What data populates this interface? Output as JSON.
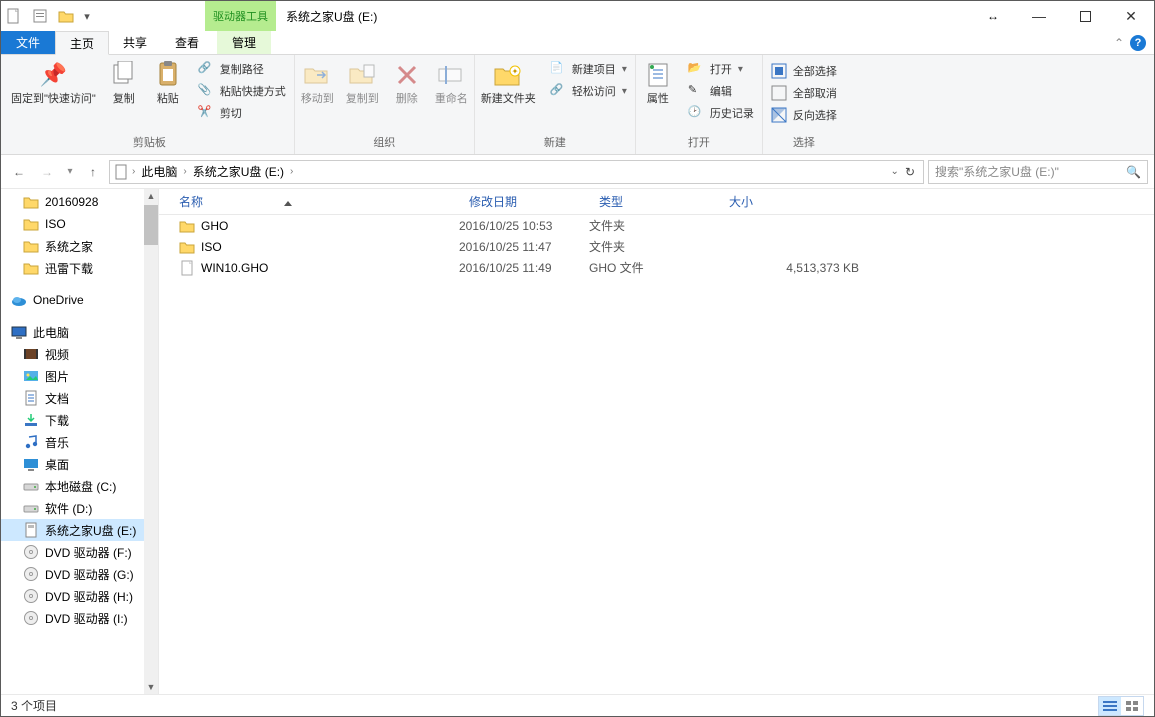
{
  "title_bar": {
    "tool_context_label": "驱动器工具",
    "window_title": "系统之家U盘 (E:)"
  },
  "tabs": {
    "file": "文件",
    "home": "主页",
    "share": "共享",
    "view": "查看",
    "manage": "管理"
  },
  "ribbon": {
    "clipboard": {
      "pin": "固定到\"快速访问\"",
      "copy": "复制",
      "paste": "粘贴",
      "copy_path": "复制路径",
      "paste_shortcut": "粘贴快捷方式",
      "cut": "剪切",
      "group": "剪贴板"
    },
    "organize": {
      "move_to": "移动到",
      "copy_to": "复制到",
      "delete": "删除",
      "rename": "重命名",
      "group": "组织"
    },
    "new": {
      "new_folder": "新建文件夹",
      "new_item": "新建项目",
      "easy_access": "轻松访问",
      "group": "新建"
    },
    "open": {
      "properties": "属性",
      "open": "打开",
      "edit": "编辑",
      "history": "历史记录",
      "group": "打开"
    },
    "select": {
      "select_all": "全部选择",
      "select_none": "全部取消",
      "invert": "反向选择",
      "group": "选择"
    }
  },
  "breadcrumb": {
    "root": "此电脑",
    "current": "系统之家U盘 (E:)"
  },
  "search": {
    "placeholder": "搜索\"系统之家U盘 (E:)\""
  },
  "tree": [
    {
      "label": "20160928",
      "icon": "folder",
      "depth": 1
    },
    {
      "label": "ISO",
      "icon": "folder",
      "depth": 1
    },
    {
      "label": "系统之家",
      "icon": "folder",
      "depth": 1
    },
    {
      "label": "迅雷下载",
      "icon": "folder",
      "depth": 1
    },
    {
      "label": "OneDrive",
      "icon": "onedrive",
      "depth": 0,
      "spaced": true
    },
    {
      "label": "此电脑",
      "icon": "pc",
      "depth": 0,
      "spaced": true
    },
    {
      "label": "视频",
      "icon": "video",
      "depth": 1
    },
    {
      "label": "图片",
      "icon": "pictures",
      "depth": 1
    },
    {
      "label": "文档",
      "icon": "docs",
      "depth": 1
    },
    {
      "label": "下载",
      "icon": "downloads",
      "depth": 1
    },
    {
      "label": "音乐",
      "icon": "music",
      "depth": 1
    },
    {
      "label": "桌面",
      "icon": "desktop",
      "depth": 1
    },
    {
      "label": "本地磁盘 (C:)",
      "icon": "drive",
      "depth": 1
    },
    {
      "label": "软件 (D:)",
      "icon": "drive",
      "depth": 1
    },
    {
      "label": "系统之家U盘 (E:)",
      "icon": "usb",
      "depth": 1,
      "selected": true
    },
    {
      "label": "DVD 驱动器 (F:)",
      "icon": "dvd",
      "depth": 1
    },
    {
      "label": "DVD 驱动器 (G:)",
      "icon": "dvd",
      "depth": 1
    },
    {
      "label": "DVD 驱动器 (H:)",
      "icon": "dvd",
      "depth": 1
    },
    {
      "label": "DVD 驱动器 (I:)",
      "icon": "dvd",
      "depth": 1
    }
  ],
  "columns": {
    "name": "名称",
    "date": "修改日期",
    "type": "类型",
    "size": "大小"
  },
  "rows": [
    {
      "name": "GHO",
      "date": "2016/10/25 10:53",
      "type": "文件夹",
      "size": "",
      "icon": "folder"
    },
    {
      "name": "ISO",
      "date": "2016/10/25 11:47",
      "type": "文件夹",
      "size": "",
      "icon": "folder"
    },
    {
      "name": "WIN10.GHO",
      "date": "2016/10/25 11:49",
      "type": "GHO 文件",
      "size": "4,513,373 KB",
      "icon": "file"
    }
  ],
  "status": {
    "count": "3 个项目"
  }
}
